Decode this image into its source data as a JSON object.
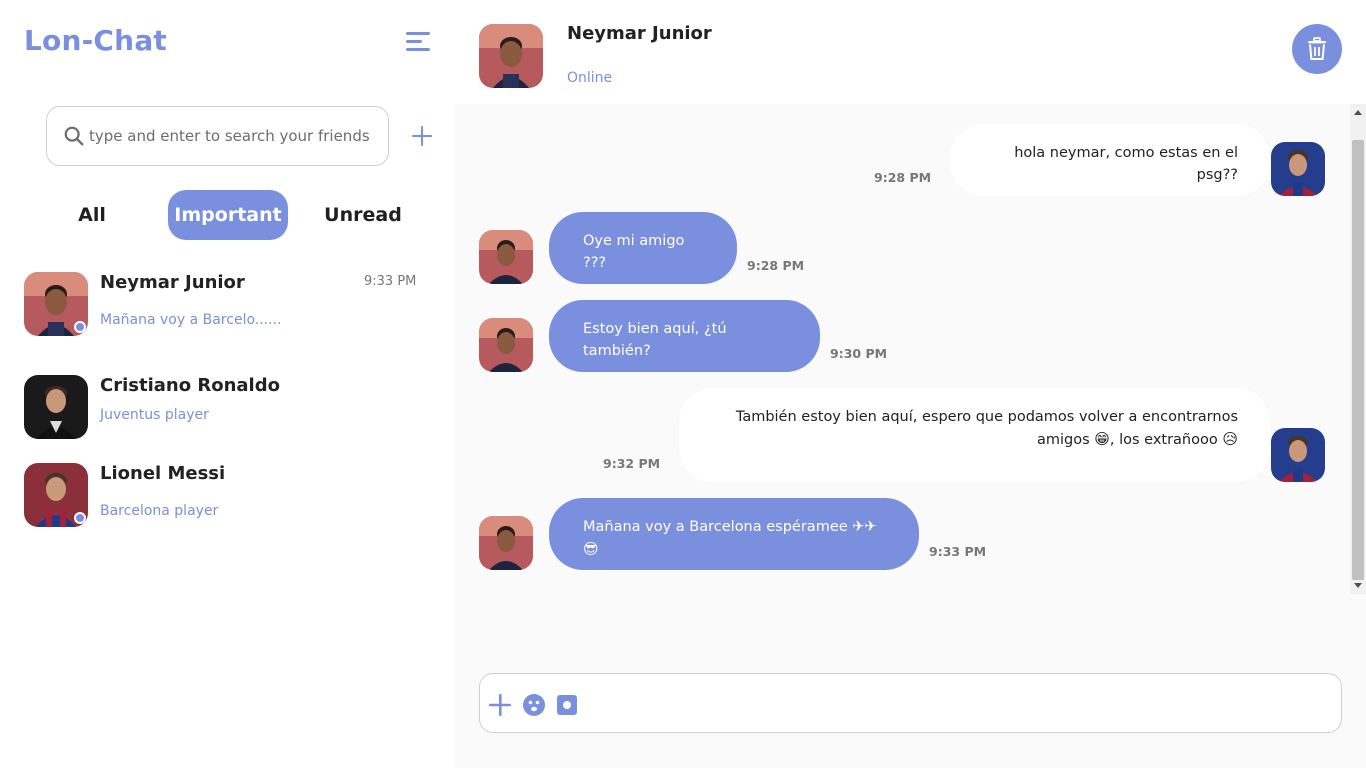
{
  "app": {
    "brand": "Lon-Chat",
    "accent_color": "#7b8fdf"
  },
  "sidebar": {
    "menu_icon": "menu-icon",
    "search": {
      "placeholder": "type and enter to search your friends",
      "value": "",
      "icon": "search-icon"
    },
    "add_friend_icon": "plus-icon",
    "tabs": [
      {
        "label": "All",
        "active": false
      },
      {
        "label": "Important",
        "active": true
      },
      {
        "label": "Unread",
        "active": false
      }
    ],
    "contacts": [
      {
        "name": "Neymar Junior",
        "subtitle": "Mañana voy a Barcelo......",
        "time": "9:33 PM",
        "online": true
      },
      {
        "name": "Cristiano Ronaldo",
        "subtitle": "Juventus player",
        "time": "",
        "online": false
      },
      {
        "name": "Lionel Messi",
        "subtitle": "Barcelona player",
        "time": "",
        "online": true
      }
    ]
  },
  "chat": {
    "header": {
      "name": "Neymar Junior",
      "status": "Online",
      "delete_icon": "trash-icon"
    },
    "messages": [
      {
        "direction": "out",
        "text": "hola neymar, como estas en el psg??",
        "time": "9:28 PM"
      },
      {
        "direction": "in",
        "text": "Oye mi amigo ???",
        "time": "9:28 PM"
      },
      {
        "direction": "in",
        "text": "Estoy bien aquí, ¿tú también?",
        "time": "9:30 PM"
      },
      {
        "direction": "out",
        "text_line1": "También estoy bien aquí, espero que podamos volver a encontrarnos",
        "text_line2_a": "amigos ",
        "emoji_grin": "😁",
        "text_line2_b": ", los extrañooo ",
        "emoji_sad": "😥",
        "time": "9:32 PM"
      },
      {
        "direction": "in",
        "text": "Mañana voy a Barcelona espéramee ✈✈",
        "emoji": "😎",
        "time": "9:33 PM"
      }
    ],
    "composer": {
      "value": "",
      "tools": [
        "plus-icon",
        "emoji-icon",
        "camera-icon"
      ]
    }
  }
}
